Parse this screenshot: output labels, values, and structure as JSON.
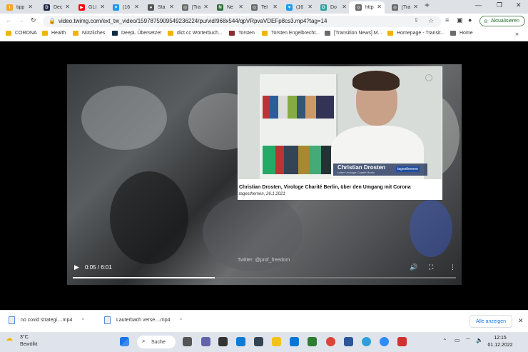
{
  "tabs": [
    {
      "label": "tipp",
      "color": "#f5a623",
      "glyph": "t"
    },
    {
      "label": "Dec",
      "color": "#1f2a44",
      "glyph": "D"
    },
    {
      "label": "GLI",
      "color": "#ff0000",
      "glyph": "▶"
    },
    {
      "label": "(16",
      "color": "#1d9bf0",
      "glyph": "♥"
    },
    {
      "label": "Sta",
      "color": "#555555",
      "glyph": "●"
    },
    {
      "label": "[Tra",
      "color": "#6b6b6b",
      "glyph": "◎"
    },
    {
      "label": "Ne",
      "color": "#2d6e3a",
      "glyph": "N"
    },
    {
      "label": "Tel",
      "color": "#6b6b6b",
      "glyph": "◎"
    },
    {
      "label": "(16",
      "color": "#1d9bf0",
      "glyph": "♥"
    },
    {
      "label": "Do",
      "color": "#2aa5a0",
      "glyph": "D"
    },
    {
      "label": "http",
      "color": "#6b6b6b",
      "glyph": "◎"
    },
    {
      "label": "[Tra",
      "color": "#6b6b6b",
      "glyph": "◎"
    }
  ],
  "url": "video.twimg.com/ext_tw_video/1597875909549236224/pu/vid/968x544/qpVRpvaVDEFp8cs3.mp4?tag=14",
  "update_label": "Aktualisieren",
  "bookmarks": [
    {
      "label": "CORONA",
      "color": "#f2b400"
    },
    {
      "label": "Health",
      "color": "#f2b400"
    },
    {
      "label": "Nützliches",
      "color": "#f2b400"
    },
    {
      "label": "DeepL Übersetzer",
      "color": "#0f2b46"
    },
    {
      "label": "dict.cc Wörterbuch...",
      "color": "#f2b400"
    },
    {
      "label": "Torsten",
      "color": "#8b2c2c"
    },
    {
      "label": "Torsten Engelbrecht...",
      "color": "#f2b400"
    },
    {
      "label": "[Transition News] M...",
      "color": "#6b6b6b"
    },
    {
      "label": "Homepage - Transit...",
      "color": "#f2b400"
    },
    {
      "label": "Home",
      "color": "#6b6b6b"
    }
  ],
  "inset": {
    "lower_third_name": "Christian Drosten",
    "lower_third_role": "Leiter Virologie Charité Berlin",
    "logo": "tagesthemen",
    "caption": "Christian Drosten, Virologe Charité Berlin, über den Umgang mit Corona",
    "caption_source": "tagesthemen, 26.1.2021"
  },
  "watermark": "Twitter: @prof_freedom",
  "player": {
    "time": "0:05 / 6:01",
    "progress": 0.37
  },
  "downloads": [
    "no covid strategi....mp4",
    "Lauterbach verse....mp4"
  ],
  "show_all": "Alle anzeigen",
  "weather": {
    "temp": "3°C",
    "desc": "Bewölkt"
  },
  "taskbar_search": "Suche",
  "clock": {
    "time": "12:15",
    "date": "01.12.2022"
  }
}
